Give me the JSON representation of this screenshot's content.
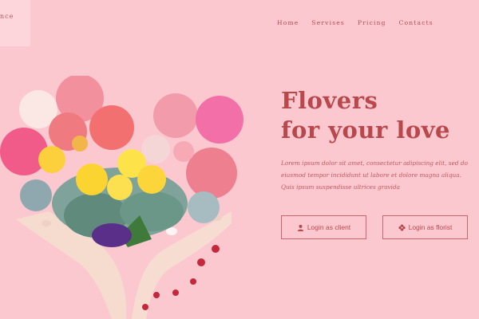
{
  "logo": {
    "text": "nce"
  },
  "nav": {
    "items": [
      "Home",
      "Servises",
      "Pricing",
      "Contacts"
    ]
  },
  "hero": {
    "title_line1": "Flovers",
    "title_line2": "for your love",
    "description": "Lorem ipsum dolor sit amet, consectetur adipiscing elit, sed do eiusmod tempor incididunt ut labore et dolore magna aliqua. Quis ipsum suspendisse ultrices gravida"
  },
  "buttons": {
    "client_label": "Login as client",
    "florist_label": "Login as florist"
  },
  "colors": {
    "background": "#fcc8d0",
    "accent": "#b8484c",
    "logo_box": "#fdd6db"
  },
  "icons": {
    "client": "user-icon",
    "florist": "flower-icon"
  }
}
